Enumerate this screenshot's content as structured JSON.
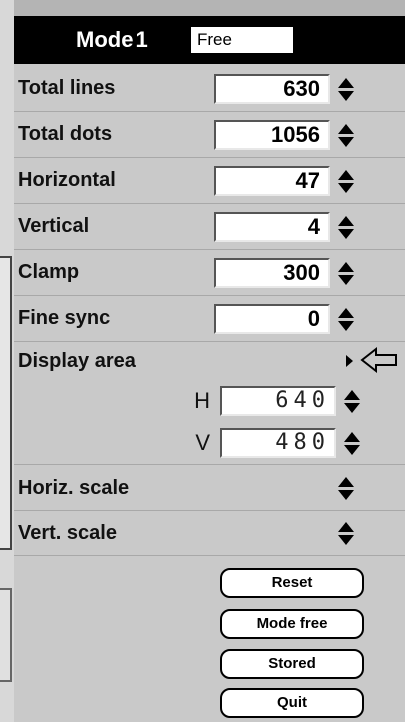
{
  "header": {
    "mode_label": "Mode",
    "mode_number": "1",
    "mode_name": "Free"
  },
  "rows": [
    {
      "label": "Total lines",
      "value": "630"
    },
    {
      "label": "Total dots",
      "value": "1056"
    },
    {
      "label": "Horizontal",
      "value": "47"
    },
    {
      "label": "Vertical",
      "value": "4"
    },
    {
      "label": "Clamp",
      "value": "300"
    },
    {
      "label": "Fine sync",
      "value": "0"
    }
  ],
  "display_area": {
    "label": "Display area",
    "h_label": "H",
    "h_value": "640",
    "v_label": "V",
    "v_value": "480"
  },
  "scales": {
    "horiz": "Horiz. scale",
    "vert": "Vert. scale"
  },
  "buttons": {
    "reset": "Reset",
    "mode_free": "Mode free",
    "stored": "Stored",
    "quit": "Quit"
  }
}
